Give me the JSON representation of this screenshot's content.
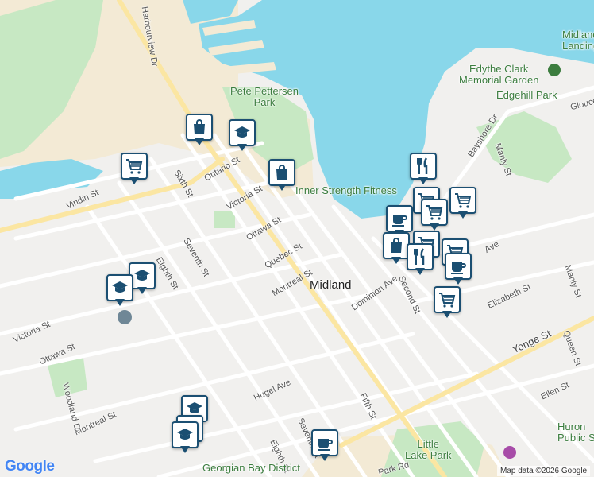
{
  "map": {
    "colors": {
      "water": "#89d7ea",
      "park": "#c7e8c3",
      "land": "#f1f0ee",
      "sand": "#f3ead5",
      "road": "#ffffff",
      "road_outline": "#d3d3d3",
      "highway": "#fbe6a2",
      "pin_border": "#1b4f72"
    },
    "labels": {
      "harbourview": "Harbourview Dr",
      "pete_pettersen": "Pete Pettersen\nPark",
      "inner_strength": "Inner Strength Fitness",
      "edythe_clark": "Edythe Clark\nMemorial Garden",
      "edgehill": "Edgehill Park",
      "midland_landing": "Midland\nLanding",
      "glouce": "Glouce",
      "bayshore": "Bayshore Dr",
      "manly_top": "Manly St",
      "ontario": "Ontario St",
      "victoria_top": "Victoria St",
      "ottawa_top": "Ottawa St",
      "quebec": "Quebec St",
      "montreal_top": "Montreal St",
      "sixth": "Sixth St",
      "seventh_top": "Seventh St",
      "eighth_top": "Eighth St",
      "vindin": "Vindin St",
      "midland": "Midland",
      "dominion": "Dominion Ave",
      "second": "Second St",
      "ave_partial": "Ave",
      "manly_bottom": "Manly St",
      "elizabeth": "Elizabeth St",
      "yonge": "Yonge St",
      "queen": "Queen St",
      "ellen": "Ellen St",
      "victoria_left": "Victoria St",
      "ottawa_left": "Ottawa St",
      "woodland": "Woodland Dr",
      "montreal_left": "Montreal St",
      "hugel": "Hugel Ave",
      "fifth": "Fifth St",
      "seventh_bottom": "Seventh St",
      "eighth_bottom": "Eighth St",
      "little_lake": "Little\nLake Park",
      "huron": "Huron\nPublic Sc",
      "park_rd": "Park Rd",
      "georgian_bay": "Georgian Bay District",
      "attribution": "Map data ©2026 Google",
      "google": "Google"
    },
    "markers": [
      {
        "name": "marker-shopping-bag-1",
        "icon": "shopping-bag-icon"
      },
      {
        "name": "marker-school-1",
        "icon": "graduation-cap-icon"
      },
      {
        "name": "marker-grocery-1",
        "icon": "shopping-cart-icon"
      },
      {
        "name": "marker-shopping-bag-2",
        "icon": "shopping-bag-icon"
      },
      {
        "name": "marker-restaurant-1",
        "icon": "fork-knife-icon"
      },
      {
        "name": "marker-grocery-2",
        "icon": "shopping-cart-icon"
      },
      {
        "name": "marker-grocery-3",
        "icon": "shopping-cart-icon"
      },
      {
        "name": "marker-cafe-1",
        "icon": "coffee-cup-icon"
      },
      {
        "name": "marker-grocery-4",
        "icon": "shopping-cart-icon"
      },
      {
        "name": "marker-shopping-bag-3",
        "icon": "shopping-bag-icon"
      },
      {
        "name": "marker-grocery-5",
        "icon": "shopping-cart-icon"
      },
      {
        "name": "marker-restaurant-2",
        "icon": "fork-knife-icon"
      },
      {
        "name": "marker-grocery-6",
        "icon": "shopping-cart-icon"
      },
      {
        "name": "marker-cafe-2",
        "icon": "coffee-cup-icon"
      },
      {
        "name": "marker-grocery-7",
        "icon": "shopping-cart-icon"
      },
      {
        "name": "marker-school-2",
        "icon": "graduation-cap-icon"
      },
      {
        "name": "marker-school-3",
        "icon": "graduation-cap-icon"
      },
      {
        "name": "marker-school-4",
        "icon": "graduation-cap-icon"
      },
      {
        "name": "marker-school-5",
        "icon": "graduation-cap-icon"
      },
      {
        "name": "marker-school-6",
        "icon": "graduation-cap-icon"
      },
      {
        "name": "marker-cafe-3",
        "icon": "coffee-cup-icon"
      }
    ]
  }
}
